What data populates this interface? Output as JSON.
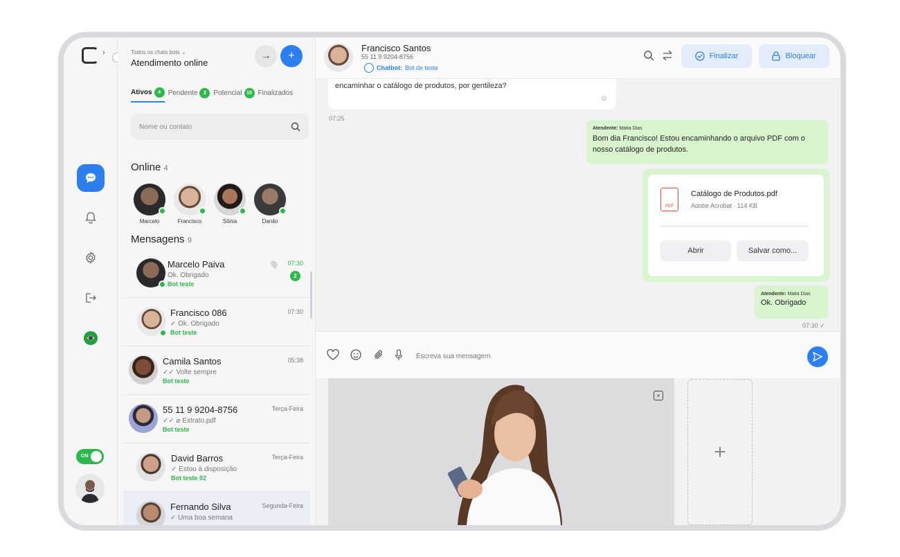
{
  "sidebar": {
    "logo_icon": "logo-icon",
    "items": [
      {
        "name": "chat-icon",
        "active": true
      },
      {
        "name": "bell-icon",
        "active": false
      },
      {
        "name": "gear-icon",
        "active": false
      },
      {
        "name": "logout-icon",
        "active": false
      },
      {
        "name": "brazil-flag-icon",
        "active": false
      }
    ],
    "toggle_label": "ON"
  },
  "list": {
    "subtitle": "Todos os chats bots",
    "title": "Atendimento online",
    "tabs": [
      {
        "label": "Ativos",
        "count": "4"
      },
      {
        "label": "Pendente",
        "count": "2"
      },
      {
        "label": "Potencial",
        "count": "15"
      },
      {
        "label": "Finalizados",
        "count": ""
      }
    ],
    "search_placeholder": "Nome ou contato",
    "online_title": "Online",
    "online_count": "4",
    "online": [
      {
        "name": "Marcelo"
      },
      {
        "name": "Francisco"
      },
      {
        "name": "Sônia"
      },
      {
        "name": "Danilo"
      }
    ],
    "messages_title": "Mensagens",
    "messages_count": "9",
    "conversations": [
      {
        "name": "Marcelo Paiva",
        "last": "Ok. Obrigado",
        "bot": "Bot teste",
        "time": "07:30",
        "unread": "2"
      },
      {
        "name": "Francisco 086",
        "last": "✓ Ok. Obrigado",
        "bot": "Bot teste",
        "time": "07:30"
      },
      {
        "name": "Camila Santos",
        "last": "✓✓ Volte sempre",
        "bot": "Bot teste",
        "time": "05:38"
      },
      {
        "name": "55 11 9 9204-8756",
        "last": "✓✓ ⌀ Extrato.pdf",
        "bot": "Bot teste",
        "time": "Terça-Feira"
      },
      {
        "name": "David Barros",
        "last": "✓ Estou à disposição",
        "bot": "Bot teste 02",
        "time": "Terça-Feira"
      },
      {
        "name": "Fernando Silva",
        "last": "✓ Uma boa semana",
        "bot": "",
        "time": "Segunda-Feira"
      }
    ]
  },
  "chat": {
    "contact_name": "Francisco Santos",
    "contact_phone": "55 11 9 9204-8756",
    "chatbot_label": "Chatbot:",
    "chatbot_name": "Bot de teste",
    "finalize_label": "Finalizar",
    "block_label": "Bloquear",
    "incoming_text": "encaminhar o catálogo de produtos, por gentileza?",
    "incoming_time": "07:25",
    "out1_attendant_label": "Atendente:",
    "out1_attendant": "Matia Dias",
    "out1_text": "Bom dia Francisco! Estou encaminhando o arquivo PDF com o nosso catálogo de produtos.",
    "file_name": "Catálogo de Produtos.pdf",
    "file_meta": "Adobe Acrobat  ·  114 KB",
    "file_icon_text": "PDF",
    "open_label": "Abrir",
    "save_label": "Salvar como...",
    "out2_attendant_label": "Atendente:",
    "out2_attendant": "Matia Dias",
    "out2_text": "Ok. Obrigado",
    "out2_time": "07:30 ✓",
    "composer_placeholder": "Escreva sua mensagem"
  },
  "colors": {
    "accent": "#2d7ff0",
    "online": "#2eb84b",
    "bubble_out": "#d8f5cf"
  }
}
